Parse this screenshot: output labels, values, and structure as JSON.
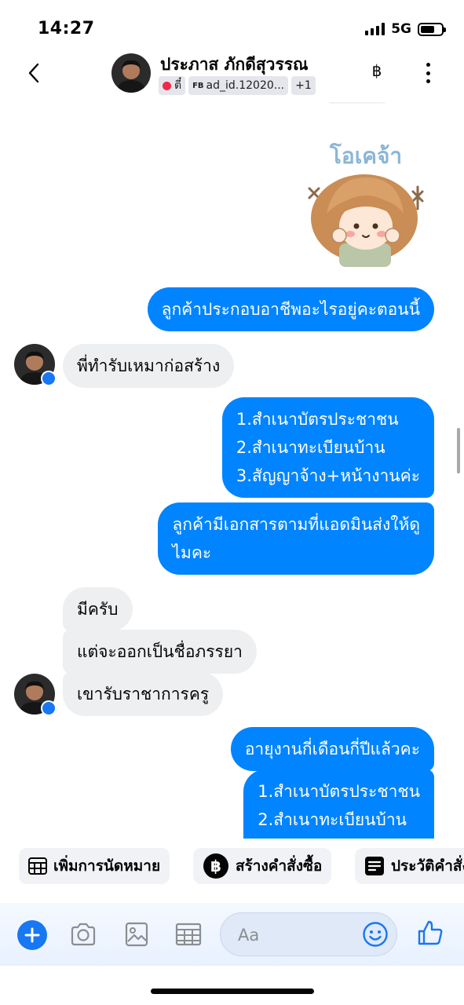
{
  "status_bar": {
    "time": "14:27",
    "network": "5G"
  },
  "header": {
    "contact_name": "ประภาส ภักดีสุวรรณ",
    "tags": {
      "label_tag": "ตี๋",
      "ad_tag_prefix": "FB",
      "ad_tag": "ad_id.12020...",
      "more_tags": "+1"
    },
    "baht_symbol": "฿"
  },
  "messages": [
    {
      "id": "m1",
      "direction": "out",
      "text": "ลูกค้าประกอบอาชีพอะไรอยู่คะตอนนี้"
    },
    {
      "id": "m2",
      "direction": "in",
      "text": "พี่ทำรับเหมาก่อสร้าง"
    },
    {
      "id": "m3",
      "direction": "out",
      "lines": [
        "1.สำเนาบัตรประชาชน",
        "2.สำเนาทะเบียนบ้าน",
        "3.สัญญาจ้าง+หน้างานค่ะ"
      ]
    },
    {
      "id": "m4",
      "direction": "out",
      "lines": [
        "ลูกค้ามีเอกสารตามที่แอดมินส่งให้ดู",
        "ไมคะ"
      ]
    },
    {
      "id": "m5",
      "direction": "in",
      "text": "มีครับ"
    },
    {
      "id": "m6",
      "direction": "in",
      "text": "แต่จะออกเป็นชื่อภรรยา"
    },
    {
      "id": "m7",
      "direction": "in",
      "text": "เขารับราชาการครู"
    },
    {
      "id": "m8",
      "direction": "out",
      "text": "อายุงานกี่เดือนกี่ปีแล้วคะ"
    },
    {
      "id": "m9",
      "direction": "out",
      "lines": [
        "1.สำเนาบัตรประชาชน",
        "2.สำเนาทะเบียนบ้าน"
      ]
    }
  ],
  "sticker": {
    "caption": "โอเคจ้า"
  },
  "quick_actions": [
    {
      "label": "เพิ่มการนัดหมาย",
      "icon": "calendar-icon"
    },
    {
      "label": "สร้างคำสั่งซื้อ",
      "icon": "baht-icon"
    },
    {
      "label": "ประวัติคำสั่งซื้อ",
      "icon": "receipt-icon"
    }
  ],
  "composer": {
    "placeholder": "Aa"
  },
  "colors": {
    "outgoing_bubble": "#0084ff",
    "incoming_bubble": "#eeeff1",
    "accent": "#1877f2"
  }
}
